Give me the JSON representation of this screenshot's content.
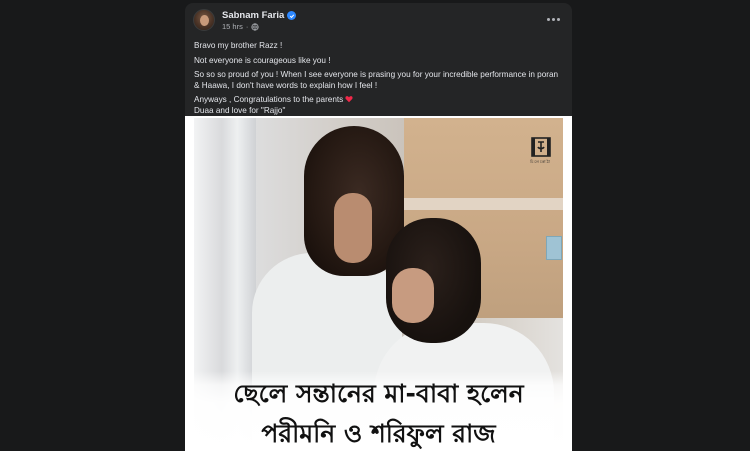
{
  "post": {
    "author": "Sabnam Faria",
    "time": "15 hrs",
    "meta_dot": "·",
    "icons": {
      "verified": "verified-badge-icon",
      "audience": "globe-icon",
      "more": "more-options-icon",
      "heart": "red-heart-icon"
    },
    "text": {
      "line1": "Bravo my brother Razz !",
      "line2": "Not everyone is courageous like you !",
      "line3": "So so so proud of you ! When I see everyone is prasing you for your incredible performance in poran & Haawa, I don't have words to explain how I feel !",
      "line4": "Anyways , Congratulations to the parents",
      "line5": "Duaa and love for \"Rajjo\""
    },
    "image": {
      "watermark_caption": "চিলেকোঠা",
      "caption_line1": "ছেলে সন্তানের মা-বাবা হলেন",
      "caption_line2": "পরীমনি ও শরিফুল রাজ"
    }
  },
  "colors": {
    "page_bg": "#18191a",
    "card_bg": "#242526",
    "text_primary": "#e4e6eb",
    "text_secondary": "#b0b3b8",
    "verified_blue": "#2d88ff",
    "heart_red": "#f02849"
  }
}
